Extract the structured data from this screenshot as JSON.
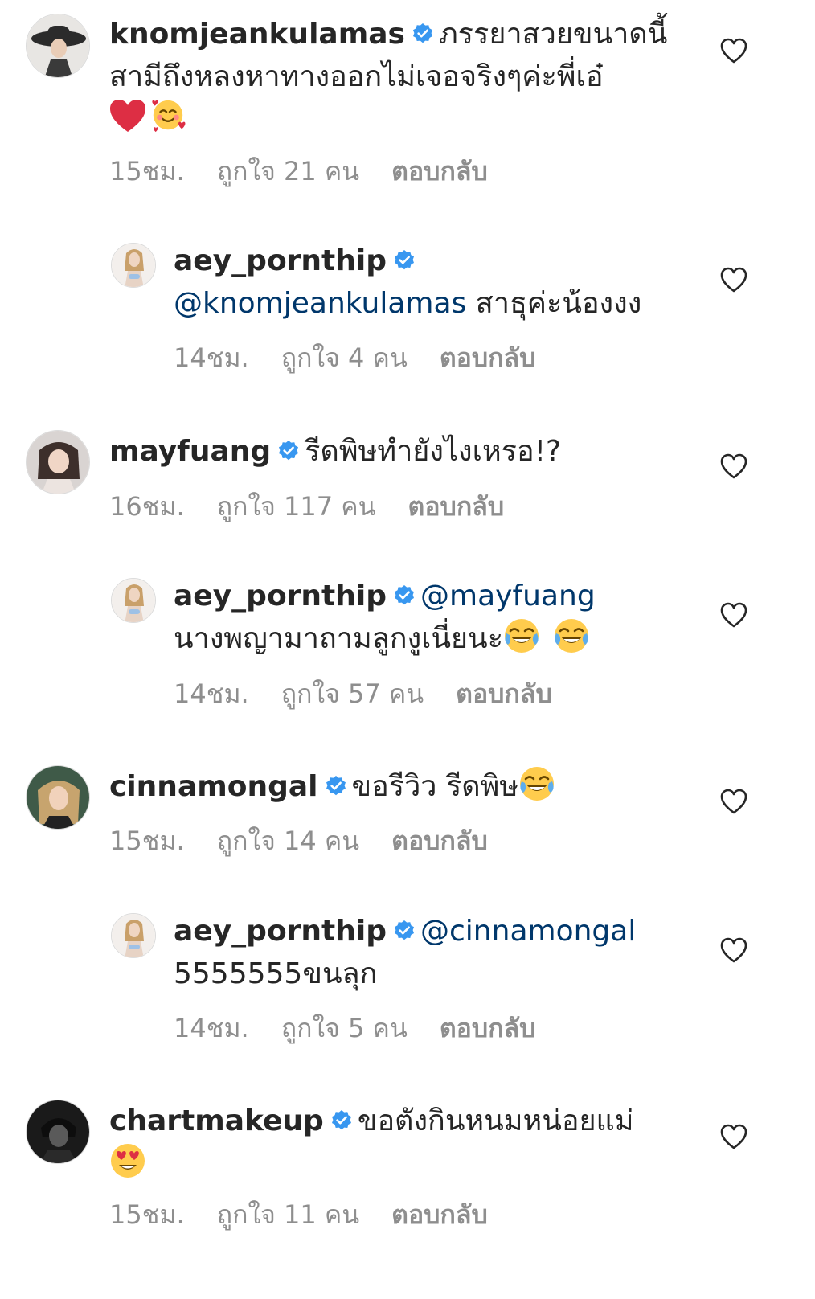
{
  "comments": [
    {
      "username": "knomjeankulamas",
      "text": "ภรรยาสวยขนาดนี้สามีถึงหลงหาทางออกไม่เจอจริงๆค่ะพี่เอ๋",
      "time": "15ชม.",
      "likes": "ถูกใจ 21 คน",
      "reply": "ตอบกลับ",
      "emoji": [
        "heart-emoji",
        "smiling-face-with-hearts-emoji"
      ]
    },
    {
      "username": "aey_pornthip",
      "mention": "@knomjeankulamas",
      "text": "สาธุค่ะน้องงง",
      "time": "14ชม.",
      "likes": "ถูกใจ 4 คน",
      "reply": "ตอบกลับ"
    },
    {
      "username": "mayfuang",
      "text": "รีดพิษทำยังไงเหรอ!?",
      "time": "16ชม.",
      "likes": "ถูกใจ 117 คน",
      "reply": "ตอบกลับ"
    },
    {
      "username": "aey_pornthip",
      "mention": "@mayfuang",
      "text": "นางพญามาถามลูกงูเนี่ยนะ",
      "time": "14ชม.",
      "likes": "ถูกใจ 57 คน",
      "reply": "ตอบกลับ",
      "emoji": [
        "tears-of-joy-emoji",
        "tears-of-joy-emoji"
      ]
    },
    {
      "username": "cinnamongal",
      "text": "ขอรีวิว รีดพิษ",
      "time": "15ชม.",
      "likes": "ถูกใจ 14 คน",
      "reply": "ตอบกลับ",
      "emoji": [
        "tears-of-joy-emoji"
      ]
    },
    {
      "username": "aey_pornthip",
      "mention": "@cinnamongal",
      "text": "5555555ขนลุก",
      "time": "14ชม.",
      "likes": "ถูกใจ 5 คน",
      "reply": "ตอบกลับ"
    },
    {
      "username": "chartmakeup",
      "text": "ขอตังกินหนมหน่อยแม่",
      "time": "15ชม.",
      "likes": "ถูกใจ 11 คน",
      "reply": "ตอบกลับ",
      "emoji": [
        "heart-eyes-emoji"
      ]
    }
  ],
  "colors": {
    "text": "#262626",
    "meta": "#8e8e8e",
    "mention": "#00376b",
    "verified": "#3897f0"
  }
}
